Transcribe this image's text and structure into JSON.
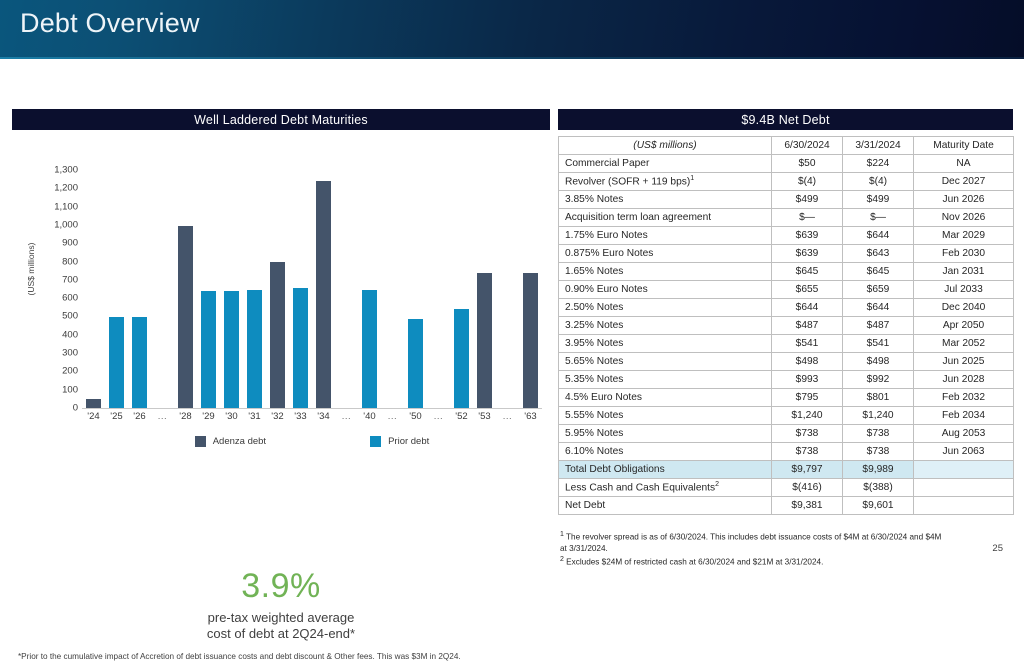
{
  "header": {
    "title": "Debt Overview"
  },
  "left": {
    "panel_title": "Well Laddered Debt Maturities",
    "legend": [
      {
        "label": "Adenza debt",
        "color": "#44546a",
        "key": "adenza"
      },
      {
        "label": "Prior debt",
        "color": "#0e8cbf",
        "key": "prior"
      }
    ],
    "big_stat": "3.9%",
    "stat_caption_line1": "pre-tax weighted average",
    "stat_caption_line2": "cost of debt at 2Q24-end*",
    "footnote": "*Prior to the cumulative impact of Accretion of debt issuance costs and debt discount & Other fees. This was $3M in 2Q24."
  },
  "chart_data": {
    "type": "bar",
    "title": "Well Laddered Debt Maturities",
    "xlabel": "",
    "ylabel": "(US$ millions)",
    "ylim": [
      0,
      1300
    ],
    "ytick_step": 100,
    "ytick_labels": [
      "1,300",
      "1,200",
      "1,100",
      "1,000",
      "900",
      "800",
      "700",
      "600",
      "500",
      "400",
      "300",
      "200",
      "100",
      "0"
    ],
    "grid": false,
    "legend_position": "bottom",
    "legend": [
      "Adenza debt",
      "Prior debt"
    ],
    "categories": [
      "'24",
      "'25",
      "'26",
      "...",
      "'28",
      "'29",
      "'30",
      "'31",
      "'32",
      "'33",
      "'34",
      "...",
      "'40",
      "...",
      "'50",
      "...",
      "'52",
      "'53",
      "...",
      "'63"
    ],
    "points": [
      {
        "category": "'24",
        "value": 50,
        "series": "Adenza debt"
      },
      {
        "category": "'25",
        "value": 498,
        "series": "Prior debt"
      },
      {
        "category": "'26",
        "value": 499,
        "series": "Prior debt"
      },
      {
        "category": "...",
        "value": 0,
        "series": "none"
      },
      {
        "category": "'28",
        "value": 993,
        "series": "Adenza debt"
      },
      {
        "category": "'29",
        "value": 639,
        "series": "Prior debt"
      },
      {
        "category": "'30",
        "value": 639,
        "series": "Prior debt"
      },
      {
        "category": "'31",
        "value": 645,
        "series": "Prior debt"
      },
      {
        "category": "'32",
        "value": 795,
        "series": "Adenza debt"
      },
      {
        "category": "'33",
        "value": 655,
        "series": "Prior debt"
      },
      {
        "category": "'34",
        "value": 1240,
        "series": "Adenza debt"
      },
      {
        "category": "...",
        "value": 0,
        "series": "none"
      },
      {
        "category": "'40",
        "value": 644,
        "series": "Prior debt"
      },
      {
        "category": "...",
        "value": 0,
        "series": "none"
      },
      {
        "category": "'50",
        "value": 487,
        "series": "Prior debt"
      },
      {
        "category": "...",
        "value": 0,
        "series": "none"
      },
      {
        "category": "'52",
        "value": 541,
        "series": "Prior debt"
      },
      {
        "category": "'53",
        "value": 738,
        "series": "Adenza debt"
      },
      {
        "category": "...",
        "value": 0,
        "series": "none"
      },
      {
        "category": "'63",
        "value": 738,
        "series": "Adenza debt"
      }
    ]
  },
  "right": {
    "panel_title": "$9.4B Net Debt",
    "columns": [
      "(US$ millions)",
      "6/30/2024",
      "3/31/2024",
      "Maturity Date"
    ],
    "rows": [
      {
        "label": "Commercial Paper",
        "sup": "",
        "c1": "$50",
        "c2": "$224",
        "maturity": "NA",
        "highlight": false
      },
      {
        "label": "Revolver (SOFR + 119 bps)",
        "sup": "1",
        "c1": "$(4)",
        "c2": "$(4)",
        "maturity": "Dec 2027",
        "highlight": false
      },
      {
        "label": "3.85% Notes",
        "sup": "",
        "c1": "$499",
        "c2": "$499",
        "maturity": "Jun 2026",
        "highlight": false
      },
      {
        "label": "Acquisition term loan agreement",
        "sup": "",
        "c1": "$—",
        "c2": "$—",
        "maturity": "Nov 2026",
        "highlight": false
      },
      {
        "label": "1.75% Euro Notes",
        "sup": "",
        "c1": "$639",
        "c2": "$644",
        "maturity": "Mar 2029",
        "highlight": false
      },
      {
        "label": "0.875% Euro Notes",
        "sup": "",
        "c1": "$639",
        "c2": "$643",
        "maturity": "Feb 2030",
        "highlight": false
      },
      {
        "label": "1.65% Notes",
        "sup": "",
        "c1": "$645",
        "c2": "$645",
        "maturity": "Jan 2031",
        "highlight": false
      },
      {
        "label": "0.90% Euro Notes",
        "sup": "",
        "c1": "$655",
        "c2": "$659",
        "maturity": "Jul 2033",
        "highlight": false
      },
      {
        "label": "2.50% Notes",
        "sup": "",
        "c1": "$644",
        "c2": "$644",
        "maturity": "Dec 2040",
        "highlight": false
      },
      {
        "label": "3.25% Notes",
        "sup": "",
        "c1": "$487",
        "c2": "$487",
        "maturity": "Apr 2050",
        "highlight": false
      },
      {
        "label": "3.95% Notes",
        "sup": "",
        "c1": "$541",
        "c2": "$541",
        "maturity": "Mar 2052",
        "highlight": false
      },
      {
        "label": "5.65% Notes",
        "sup": "",
        "c1": "$498",
        "c2": "$498",
        "maturity": "Jun 2025",
        "highlight": false
      },
      {
        "label": "5.35% Notes",
        "sup": "",
        "c1": "$993",
        "c2": "$992",
        "maturity": "Jun 2028",
        "highlight": false
      },
      {
        "label": "4.5% Euro Notes",
        "sup": "",
        "c1": "$795",
        "c2": "$801",
        "maturity": "Feb 2032",
        "highlight": false
      },
      {
        "label": "5.55% Notes",
        "sup": "",
        "c1": "$1,240",
        "c2": "$1,240",
        "maturity": "Feb 2034",
        "highlight": false
      },
      {
        "label": "5.95% Notes",
        "sup": "",
        "c1": "$738",
        "c2": "$738",
        "maturity": "Aug 2053",
        "highlight": false
      },
      {
        "label": "6.10% Notes",
        "sup": "",
        "c1": "$738",
        "c2": "$738",
        "maturity": "Jun 2063",
        "highlight": false
      },
      {
        "label": "Total Debt Obligations",
        "sup": "",
        "c1": "$9,797",
        "c2": "$9,989",
        "maturity": "",
        "highlight": true
      },
      {
        "label": "Less Cash and Cash Equivalents",
        "sup": "2",
        "c1": "$(416)",
        "c2": "$(388)",
        "maturity": "",
        "highlight": false
      },
      {
        "label": "Net Debt",
        "sup": "",
        "c1": "$9,381",
        "c2": "$9,601",
        "maturity": "",
        "highlight": false
      }
    ],
    "footnote_1_sup": "1",
    "footnote_1": " The revolver spread is as of 6/30/2024. This includes debt issuance costs of $4M at 6/30/2024 and $4M at 3/31/2024.",
    "footnote_2_sup": "2",
    "footnote_2": " Excludes $24M of restricted cash at 6/30/2024 and $21M at 3/31/2024.",
    "page_number": "25"
  }
}
